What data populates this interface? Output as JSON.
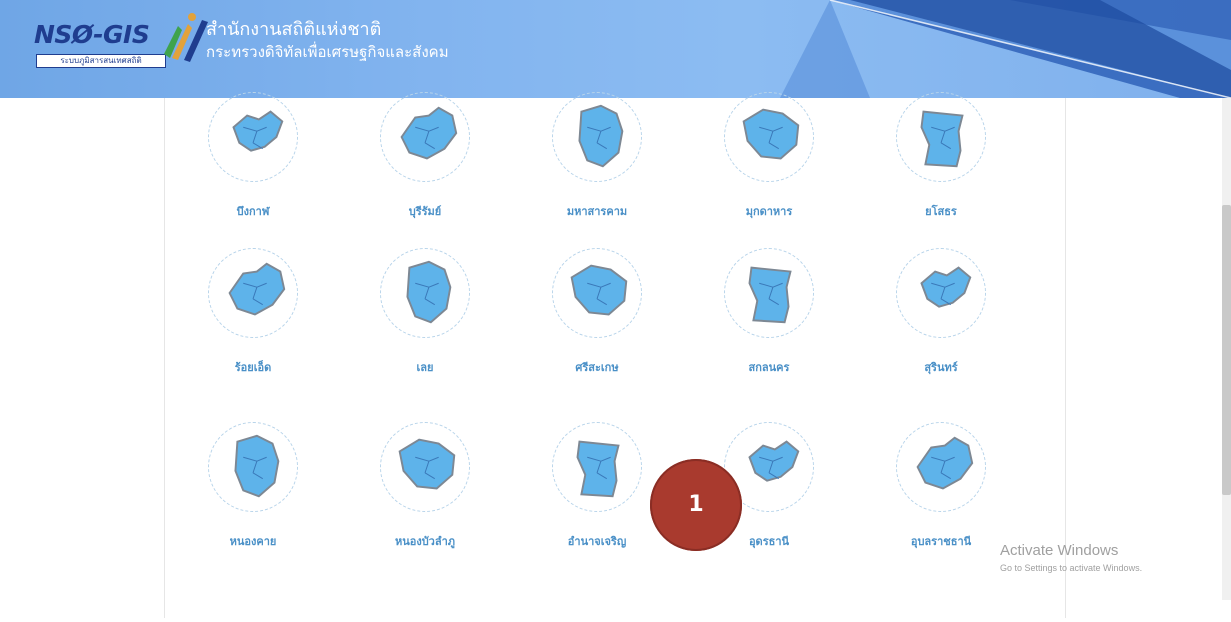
{
  "header": {
    "logo_text": "NSØ-GIS",
    "logo_subtitle": "ระบบภูมิสารสนเทศสถิติ",
    "org_name": "สำนักงานสถิติแห่งชาติ",
    "ministry": "กระทรวงดิจิทัลเพื่อเศรษฐกิจและสังคม"
  },
  "provinces": [
    {
      "label": "บึงกาฬ",
      "icon": "province-map-icon"
    },
    {
      "label": "บุรีรัมย์",
      "icon": "province-map-icon"
    },
    {
      "label": "มหาสารคาม",
      "icon": "province-map-icon"
    },
    {
      "label": "มุกดาหาร",
      "icon": "province-map-icon"
    },
    {
      "label": "ยโสธร",
      "icon": "province-map-icon"
    },
    {
      "label": "ร้อยเอ็ด",
      "icon": "province-map-icon"
    },
    {
      "label": "เลย",
      "icon": "province-map-icon"
    },
    {
      "label": "ศรีสะเกษ",
      "icon": "province-map-icon"
    },
    {
      "label": "สกลนคร",
      "icon": "province-map-icon"
    },
    {
      "label": "สุรินทร์",
      "icon": "province-map-icon"
    },
    {
      "label": "หนองคาย",
      "icon": "province-map-icon"
    },
    {
      "label": "หนองบัวลำภู",
      "icon": "province-map-icon"
    },
    {
      "label": "อำนาจเจริญ",
      "icon": "province-map-icon"
    },
    {
      "label": "อุดรธานี",
      "icon": "province-map-icon"
    },
    {
      "label": "อุบลราชธานี",
      "icon": "province-map-icon"
    }
  ],
  "annotation": {
    "badge_number": "1",
    "color": "#a93a2e"
  },
  "watermark": {
    "title": "Activate Windows",
    "subtitle": "Go to Settings to activate Windows."
  },
  "colors": {
    "header": "#82b4ef",
    "label": "#4a90c7",
    "map_fill": "#5eb3ea"
  }
}
